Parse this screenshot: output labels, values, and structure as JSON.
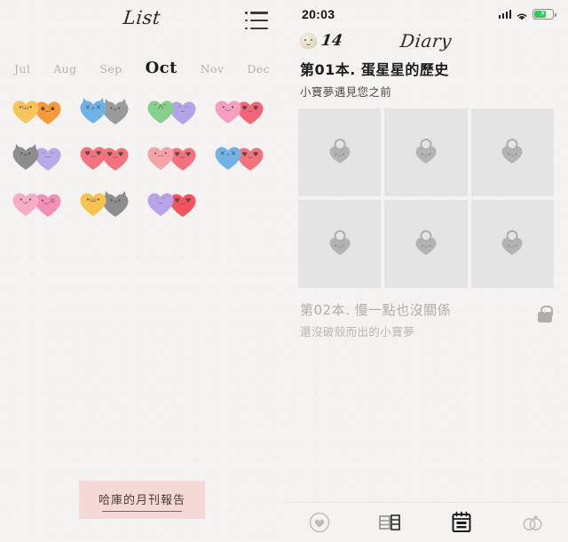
{
  "left_panel": {
    "title": "List",
    "menu_icon": "list-icon",
    "months": [
      {
        "label": "Jul",
        "active": false
      },
      {
        "label": "Aug",
        "active": false
      },
      {
        "label": "Sep",
        "active": false
      },
      {
        "label": "Oct",
        "active": true
      },
      {
        "label": "Nov",
        "active": false
      },
      {
        "label": "Dec",
        "active": false
      }
    ],
    "hearts": [
      {
        "a_color": "#f7c35a",
        "b_color": "#f49a3c",
        "a_face": "•⩊•",
        "b_face": "▪‿▪",
        "a_ears": false,
        "b_ears": false
      },
      {
        "a_color": "#6eb2e8",
        "b_color": "#9a9a9a",
        "a_face": "✕⌄✕",
        "b_face": "•ᴗ•",
        "a_ears": true,
        "b_ears": true
      },
      {
        "a_color": "#86cf8d",
        "b_color": "#b3a4e8",
        "a_face": "ﾟ∧ﾟ",
        "b_face": "ᵔ_ᵔ",
        "a_ears": false,
        "b_ears": false
      },
      {
        "a_color": "#f49ec4",
        "b_color": "#f4657a",
        "a_face": "•‿•",
        "b_face": "♥‿♥",
        "a_ears": false,
        "b_ears": false
      },
      {
        "a_color": "#8d8d8d",
        "b_color": "#b9a9e8",
        "a_face": "•ᴗ•",
        "b_face": "ᵔ﹏ᵔ",
        "a_ears": true,
        "b_ears": false
      },
      {
        "a_color": "#f4727e",
        "b_color": "#f4727e",
        "a_face": "♥‿♥",
        "b_face": "♥‿♥",
        "a_ears": false,
        "b_ears": false
      },
      {
        "a_color": "#f4a3a8",
        "b_color": "#f4727e",
        "a_face": "•﹏•",
        "b_face": "♥‿♥",
        "a_ears": false,
        "b_ears": false
      },
      {
        "a_color": "#6fb3e8",
        "b_color": "#f4727e",
        "a_face": "✕⌄✕",
        "b_face": "♥‿♥",
        "a_ears": false,
        "b_ears": false
      },
      {
        "a_color": "#f7acc6",
        "b_color": "#f490b8",
        "a_face": "•‿•",
        "b_face": "•‿⊙",
        "a_ears": false,
        "b_ears": false
      },
      {
        "a_color": "#f7c24e",
        "b_color": "#8d8d8d",
        "a_face": "•⩊•",
        "b_face": "•ᴗ•",
        "a_ears": false,
        "b_ears": true
      },
      {
        "a_color": "#b9a3e8",
        "b_color": "#f4525f",
        "a_face": "ᵔ_ᵔ",
        "b_face": "♥‿♥",
        "a_ears": false,
        "b_ears": false
      }
    ],
    "report_button": "哈庫的月刊報告"
  },
  "right_panel": {
    "status_bar": {
      "time": "20:03",
      "signal_icon": "cellular-signal-icon",
      "wifi_icon": "wifi-icon",
      "battery_icon": "battery-charging-icon",
      "battery_color": "#34c759"
    },
    "header": {
      "egg_icon": "egg-icon",
      "egg_count": "14",
      "title": "Diary"
    },
    "book_01": {
      "title": "第01本. 蛋星星的歷史",
      "subtitle": "小寶夢遇見您之前",
      "cards": [
        {
          "icon": "heart-pendant-icon",
          "face": "•ᴗ•"
        },
        {
          "icon": "heart-pendant-icon",
          "face": "•ᴗ•"
        },
        {
          "icon": "heart-pendant-icon",
          "face": "•ᴗ•"
        },
        {
          "icon": "heart-pendant-icon",
          "face": "•ᴗ•"
        },
        {
          "icon": "heart-pendant-icon",
          "face": "•ᴗ•"
        },
        {
          "icon": "heart-pendant-icon",
          "face": "•ᴗ•"
        }
      ]
    },
    "book_02": {
      "title": "第02本. 慢一點也沒關係",
      "subtitle": "還沒破殼而出的小寶夢",
      "lock_icon": "lock-icon",
      "locked": true
    },
    "tabbar": [
      {
        "name": "tab-home",
        "icon": "heart-circle-icon",
        "active": false
      },
      {
        "name": "tab-books",
        "icon": "books-icon",
        "active": false
      },
      {
        "name": "tab-diary",
        "icon": "notebook-calendar-icon",
        "active": true
      },
      {
        "name": "tab-rings",
        "icon": "wedding-rings-icon",
        "active": false
      }
    ]
  }
}
